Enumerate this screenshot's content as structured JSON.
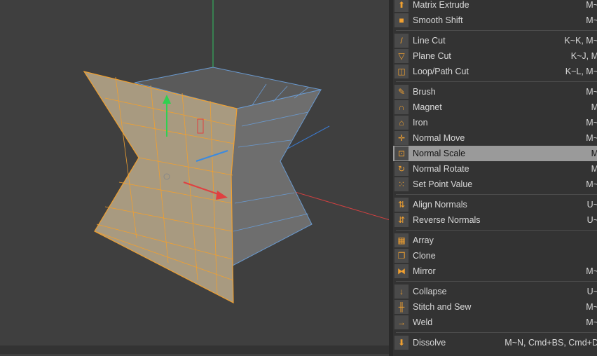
{
  "menu": {
    "groups": [
      [
        {
          "label": "Matrix Extrude",
          "shortcut": "M~",
          "icon": "matrix-extrude-icon"
        },
        {
          "label": "Smooth Shift",
          "shortcut": "M~",
          "icon": "smooth-shift-icon"
        }
      ],
      [
        {
          "label": "Line Cut",
          "shortcut": "K~K, M~",
          "icon": "knife-icon"
        },
        {
          "label": "Plane Cut",
          "shortcut": "K~J, M",
          "icon": "plane-cut-icon"
        },
        {
          "label": "Loop/Path Cut",
          "shortcut": "K~L, M~",
          "icon": "loop-cut-icon"
        }
      ],
      [
        {
          "label": "Brush",
          "shortcut": "M~",
          "icon": "brush-icon"
        },
        {
          "label": "Magnet",
          "shortcut": "M",
          "icon": "magnet-icon"
        },
        {
          "label": "Iron",
          "shortcut": "M~",
          "icon": "iron-icon"
        },
        {
          "label": "Normal Move",
          "shortcut": "M~",
          "icon": "normal-move-icon"
        },
        {
          "label": "Normal Scale",
          "shortcut": "M",
          "icon": "normal-scale-icon",
          "selected": true
        },
        {
          "label": "Normal Rotate",
          "shortcut": "M",
          "icon": "normal-rotate-icon"
        },
        {
          "label": "Set Point Value",
          "shortcut": "M~",
          "icon": "set-point-value-icon"
        }
      ],
      [
        {
          "label": "Align Normals",
          "shortcut": "U~",
          "icon": "align-normals-icon"
        },
        {
          "label": "Reverse Normals",
          "shortcut": "U~",
          "icon": "reverse-normals-icon"
        }
      ],
      [
        {
          "label": "Array",
          "shortcut": "",
          "icon": "array-icon"
        },
        {
          "label": "Clone",
          "shortcut": "",
          "icon": "clone-icon"
        },
        {
          "label": "Mirror",
          "shortcut": "M~",
          "icon": "mirror-icon"
        }
      ],
      [
        {
          "label": "Collapse",
          "shortcut": "U~",
          "icon": "collapse-icon"
        },
        {
          "label": "Stitch and Sew",
          "shortcut": "M~",
          "icon": "stitch-icon"
        },
        {
          "label": "Weld",
          "shortcut": "M~",
          "icon": "weld-icon"
        }
      ],
      [
        {
          "label": "Dissolve",
          "shortcut": "M~N, Cmd+BS, Cmd+D",
          "icon": "dissolve-icon"
        }
      ]
    ]
  },
  "colors": {
    "selection": "#f0a030",
    "axis_x": "#e04040",
    "axis_y": "#30d050",
    "axis_z": "#3a8ae0",
    "menu_highlight": "#9a9a9a"
  }
}
